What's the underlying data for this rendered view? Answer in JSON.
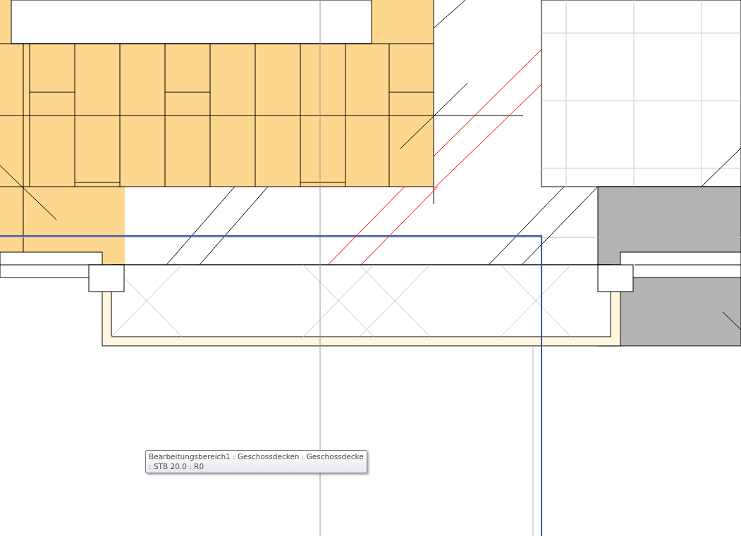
{
  "tooltip": {
    "lines": [
      "Bearbeitungsbereich1 : Geschossdecken : Geschossdecke",
      ": STB 20.0 : R0"
    ]
  }
}
